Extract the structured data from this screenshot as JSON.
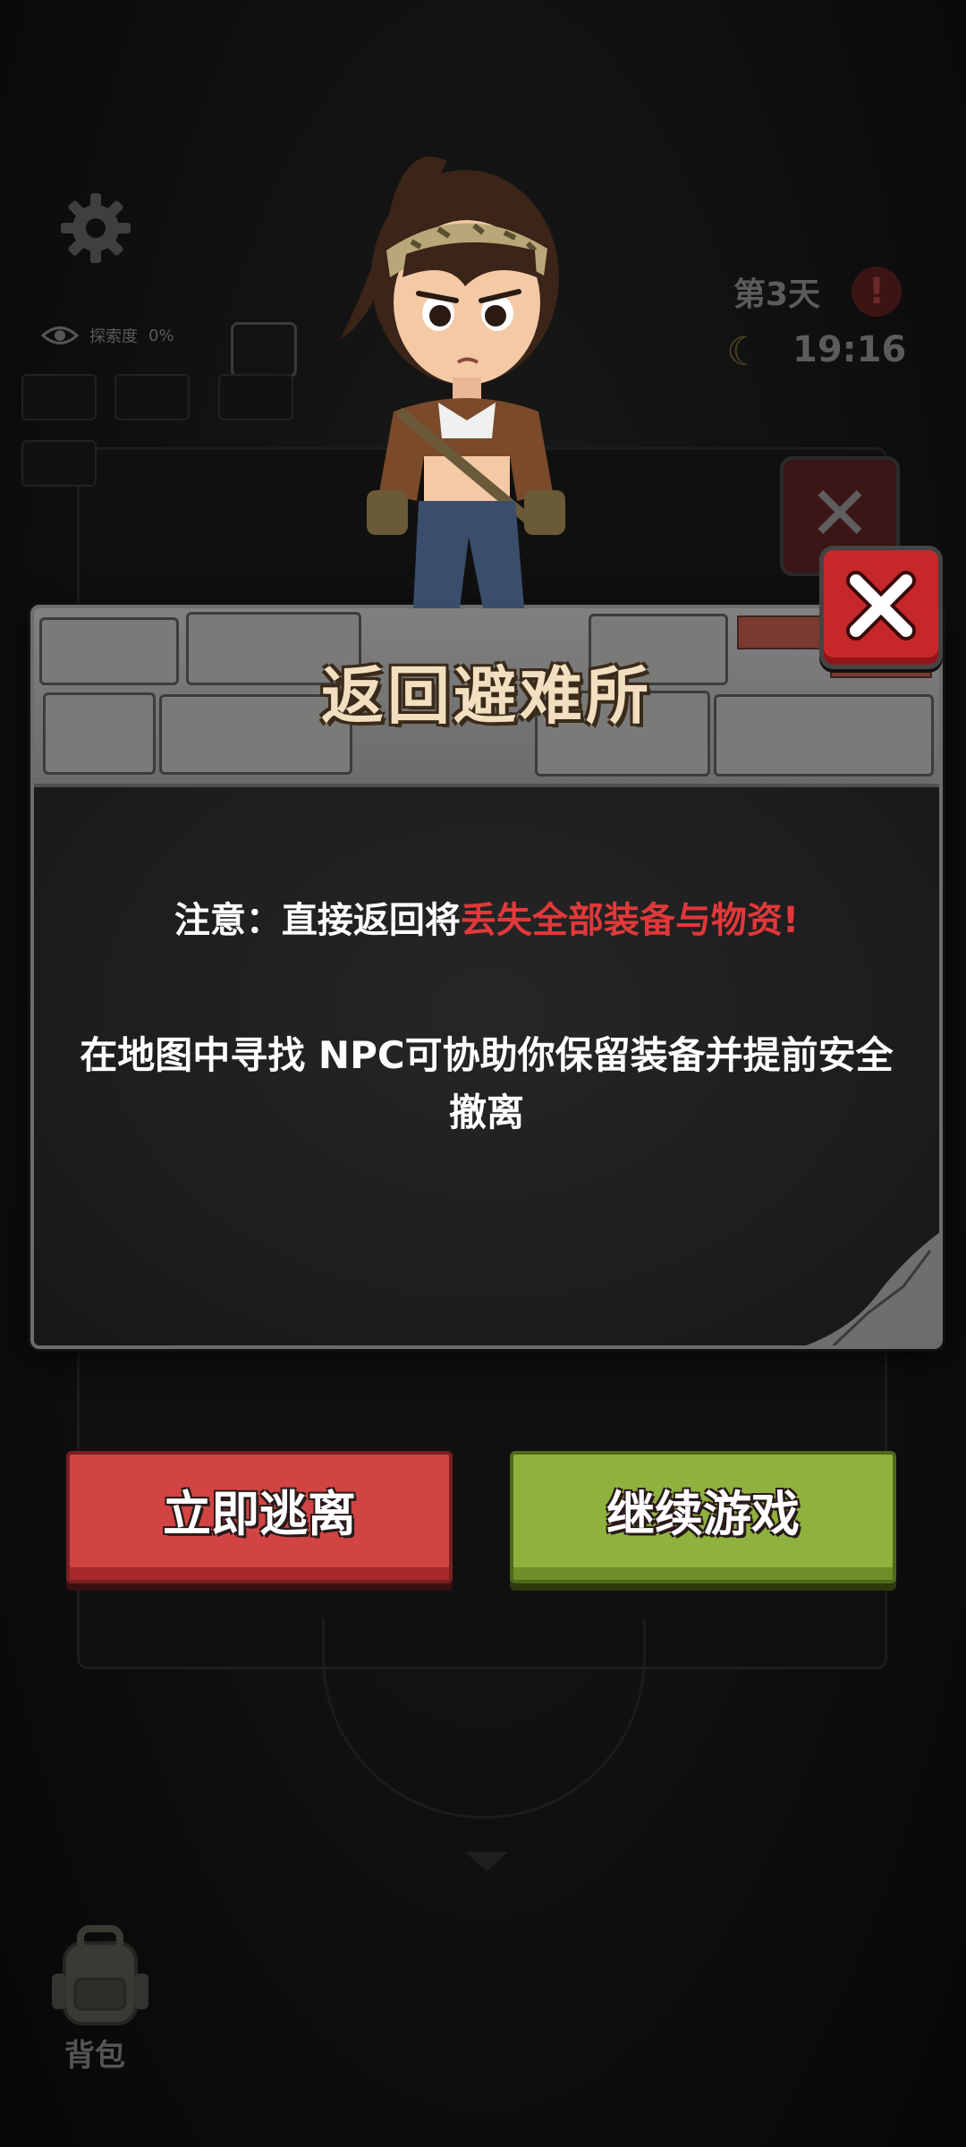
{
  "hud": {
    "explore_label": "探索度",
    "explore_value": "0%",
    "day_label": "第3天",
    "clock": "19:16"
  },
  "dialog": {
    "title": "返回避难所",
    "warning_prefix": "注意：直接返回将",
    "warning_highlight": "丢失全部装备与物资!",
    "info": "在地图中寻找 NPC可协助你保留装备并提前安全撤离"
  },
  "buttons": {
    "escape": "立即逃离",
    "continue": "继续游戏"
  },
  "bottom_bar": {
    "backpack": "背包"
  },
  "colors": {
    "warning_red": "#e2383a",
    "escape_button": "#d24444",
    "continue_button": "#8fb23e",
    "close_button": "#c6282a"
  }
}
